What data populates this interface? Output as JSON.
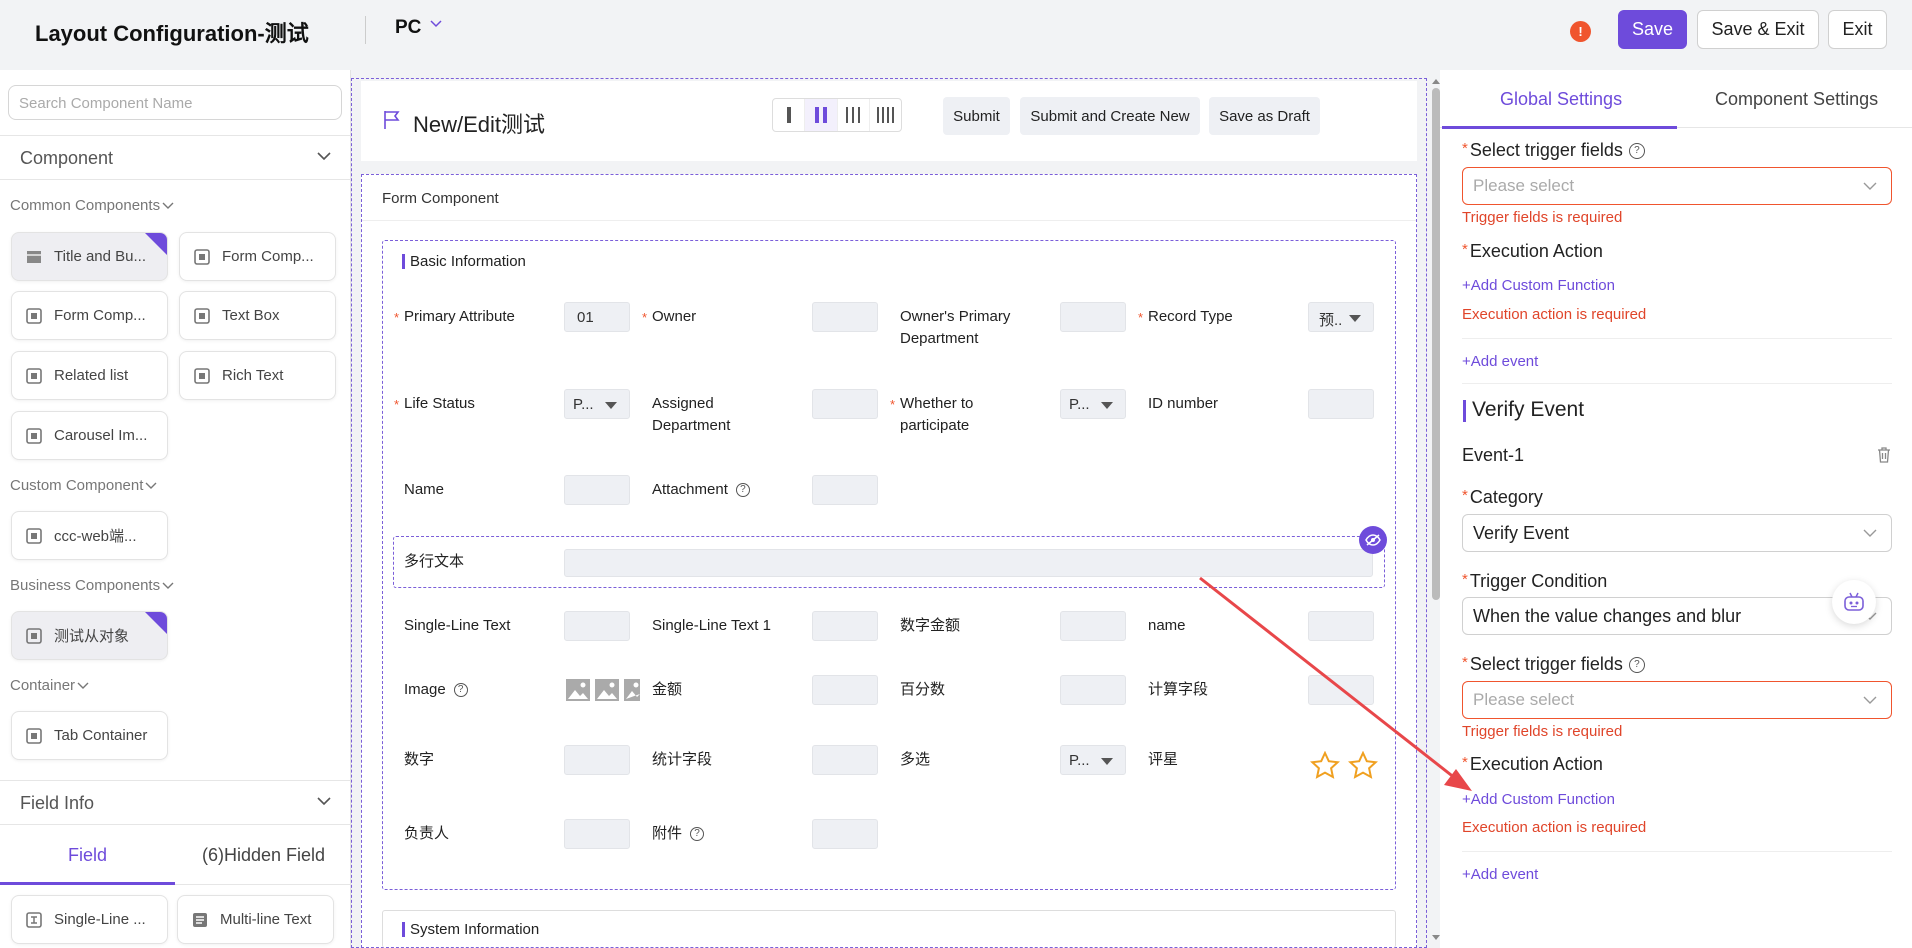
{
  "header": {
    "title": "Layout Configuration-测试",
    "device": "PC",
    "warning": "!",
    "save": "Save",
    "save_exit": "Save & Exit",
    "exit": "Exit"
  },
  "left": {
    "search_placeholder": "Search Component Name",
    "component_section": "Component",
    "groups": {
      "common": "Common Components",
      "custom": "Custom Component",
      "business": "Business Components",
      "container": "Container"
    },
    "common_items": [
      "Title and Bu...",
      "Form Comp...",
      "Form Comp...",
      "Text Box",
      "Related list",
      "Rich Text",
      "Carousel Im..."
    ],
    "custom_items": [
      "ccc-web端..."
    ],
    "business_items": [
      "测试从对象"
    ],
    "container_items": [
      "Tab Container"
    ],
    "field_info": "Field Info",
    "tabs": {
      "field": "Field",
      "hidden": "(6)Hidden Field"
    },
    "field_items": [
      "Single-Line ...",
      "Multi-line Text"
    ]
  },
  "canvas": {
    "form_title": "New/Edit测试",
    "buttons": [
      "Submit",
      "Submit and Create New",
      "Save as Draft"
    ],
    "form_component": "Form Component",
    "basic_info": "Basic Information",
    "system_info": "System Information",
    "fields": {
      "primary_attribute": "Primary Attribute",
      "primary_value": "01",
      "owner": "Owner",
      "owner_dept_1": "Owner's Primary",
      "owner_dept_2": "Department",
      "record_type": "Record Type",
      "record_value": "预..",
      "life_status": "Life Status",
      "life_value": "P...",
      "assigned_1": "Assigned",
      "assigned_2": "Department",
      "whether_1": "Whether to",
      "whether_2": "participate",
      "whether_value": "P...",
      "id_number": "ID number",
      "name": "Name",
      "attachment": "Attachment",
      "multi_text": "多行文本",
      "single_line": "Single-Line Text",
      "single_line_1": "Single-Line Text 1",
      "digital_amount": "数字金额",
      "name_lower": "name",
      "image": "Image",
      "amount": "金额",
      "percent": "百分数",
      "calc": "计算字段",
      "number": "数字",
      "stat": "统计字段",
      "multi_select": "多选",
      "multi_value": "P...",
      "rating": "评星",
      "owner_cn": "负责人",
      "attach_cn": "附件"
    }
  },
  "right": {
    "tabs": {
      "global": "Global Settings",
      "component": "Component Settings"
    },
    "select_trigger": "Select trigger fields",
    "please_select": "Please select",
    "trigger_required": "Trigger fields is required",
    "exec_action": "Execution Action",
    "add_custom": "+Add Custom Function",
    "exec_required": "Execution action is required",
    "add_event": "+Add event",
    "verify_event": "Verify Event",
    "event1": "Event-1",
    "category": "Category",
    "category_value": "Verify Event",
    "trigger_condition": "Trigger Condition",
    "trigger_value": "When the value changes and blur"
  },
  "colors": {
    "accent": "#6e4bdb",
    "error": "#f0552e",
    "arrow": "#e8474a"
  }
}
